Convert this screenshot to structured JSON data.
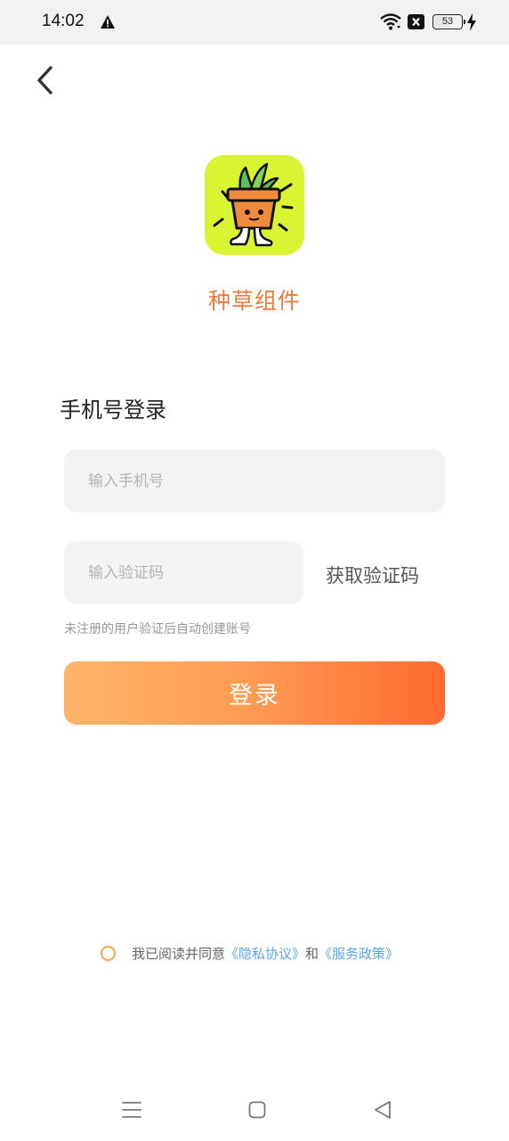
{
  "status_bar": {
    "time": "14:02",
    "battery_level": "53",
    "icons": [
      "warning-icon",
      "wifi-icon",
      "no-sim-icon",
      "battery-icon",
      "charging-icon"
    ]
  },
  "app": {
    "name": "种草组件",
    "logo_icon": "plant-pot-mascot-icon",
    "colors": {
      "logo_bg": "#d8f433",
      "name": "#f07a3a"
    }
  },
  "login": {
    "title": "手机号登录",
    "phone_placeholder": "输入手机号",
    "phone_value": "",
    "code_placeholder": "输入验证码",
    "code_value": "",
    "get_code_label": "获取验证码",
    "hint": "未注册的用户验证后自动创建账号",
    "submit_label": "登录",
    "colors": {
      "button_start": "#fdb46a",
      "button_end": "#ff6a2f"
    }
  },
  "agreement": {
    "prefix": "我已阅读并同意",
    "privacy_link": "《隐私协议》",
    "conjunction": "和",
    "service_link": "《服务政策》",
    "checked": false,
    "colors": {
      "link": "#5aa7e8",
      "radio": "#f5a94a"
    }
  },
  "nav": {
    "icons": [
      "menu-icon",
      "home-icon",
      "back-triangle-icon"
    ]
  }
}
